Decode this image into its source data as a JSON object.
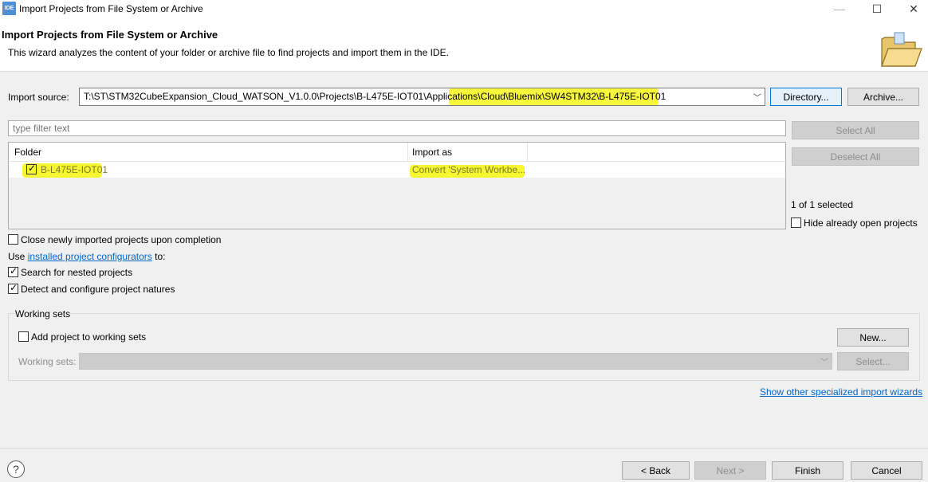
{
  "window": {
    "icon_label": "IDE",
    "title": "Import Projects from File System or Archive",
    "controls": {
      "minimize": "—",
      "maximize": "☐",
      "close": "✕"
    }
  },
  "header": {
    "title": "Import Projects from File System or Archive",
    "description": "This wizard analyzes the content of your folder or archive file to find projects and import them in the IDE."
  },
  "import_source": {
    "label": "Import source:",
    "value": "T:\\ST\\STM32CubeExpansion_Cloud_WATSON_V1.0.0\\Projects\\B-L475E-IOT01\\Applications\\Cloud\\Bluemix\\SW4STM32\\B-L475E-IOT01",
    "directory_label": "Directory...",
    "archive_label": "Archive..."
  },
  "filter": {
    "placeholder": "type filter text"
  },
  "table": {
    "columns": [
      "Folder",
      "Import as"
    ],
    "rows": [
      {
        "folder": "B-L475E-IOT01",
        "import_as": "Convert 'System Workbe...",
        "checked": true
      }
    ]
  },
  "side_panel": {
    "select_all": "Select All",
    "deselect_all": "Deselect All",
    "selected_count": "1 of 1 selected",
    "hide_open": "Hide already open projects"
  },
  "options": {
    "close_imported": "Close newly imported projects upon completion",
    "use_prefix": "Use ",
    "use_link": "installed project configurators",
    "use_suffix": " to:",
    "search_nested": "Search for nested projects",
    "detect_natures": "Detect and configure project natures"
  },
  "working_sets": {
    "title": "Working sets",
    "add_label": "Add project to working sets",
    "new_label": "New...",
    "sets_label": "Working sets:",
    "select_label": "Select..."
  },
  "show_other_link": "Show other specialized import wizards",
  "footer": {
    "help": "?",
    "back": "< Back",
    "next": "Next >",
    "finish": "Finish",
    "cancel": "Cancel"
  },
  "colors": {
    "highlight": "#f7f731",
    "link": "#0066cc",
    "accent": "#0078d7"
  }
}
